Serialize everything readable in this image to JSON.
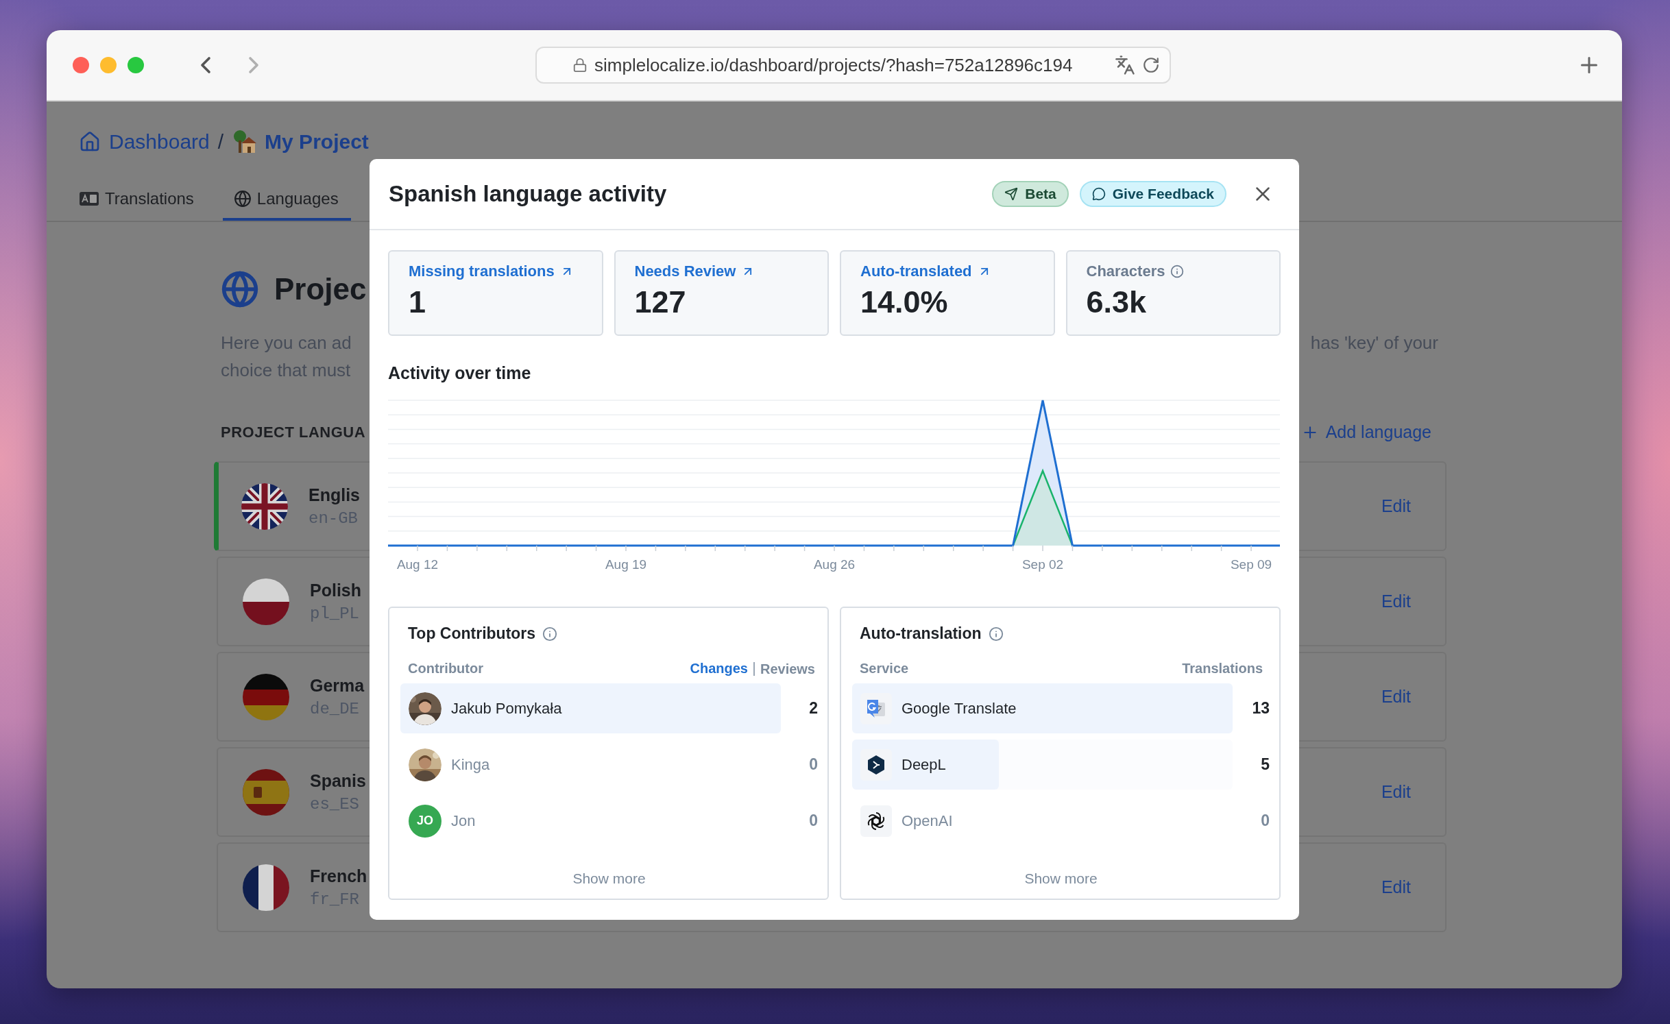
{
  "browser": {
    "url": "simplelocalize.io/dashboard/projects/?hash=752a12896c194"
  },
  "breadcrumb": {
    "root": "Dashboard",
    "separator": "/",
    "project": "My Project"
  },
  "tabs": [
    {
      "label": "Translations",
      "selected": false
    },
    {
      "label": "Languages",
      "selected": true
    }
  ],
  "page": {
    "title": "Projec",
    "description_left": [
      "Here you can ad",
      "choice that must"
    ],
    "description_right": "has 'key' of your",
    "section_heading": "PROJECT LANGUA",
    "add_button": "Add language"
  },
  "languages": [
    {
      "name": "Englis",
      "code": "en-GB",
      "default": true,
      "action": "Edit"
    },
    {
      "name": "Polish",
      "code": "pl_PL",
      "default": false,
      "action": "Edit"
    },
    {
      "name": "Germa",
      "code": "de_DE",
      "default": false,
      "action": "Edit"
    },
    {
      "name": "Spanis",
      "code": "es_ES",
      "default": false,
      "action": "Edit"
    },
    {
      "name": "French",
      "code": "fr_FR",
      "default": false,
      "action": "Edit"
    }
  ],
  "modal": {
    "title": "Spanish language activity",
    "badges": [
      {
        "label": "Beta",
        "kind": "beta"
      },
      {
        "label": "Give Feedback",
        "kind": "feedback"
      }
    ],
    "stats": [
      {
        "label": "Missing translations",
        "value": "1",
        "kind": "link"
      },
      {
        "label": "Needs Review",
        "value": "127",
        "kind": "link"
      },
      {
        "label": "Auto-translated",
        "value": "14.0%",
        "kind": "link"
      },
      {
        "label": "Characters",
        "value": "6.3k",
        "kind": "info"
      }
    ],
    "activity": {
      "title": "Activity over time",
      "x_labels": [
        "Aug 12",
        "Aug 19",
        "Aug 26",
        "Sep 02",
        "Sep 09"
      ]
    },
    "contributors": {
      "title": "Top Contributors",
      "column_1": "Contributor",
      "metrics": [
        {
          "label": "Changes",
          "selected": true
        },
        {
          "label": "Reviews",
          "selected": false
        }
      ],
      "rows": [
        {
          "name": "Jakub Pomykała",
          "value": "2",
          "level": 1,
          "muted": false
        },
        {
          "name": "Kinga",
          "value": "0",
          "muted": true
        },
        {
          "name": "Jon",
          "initials": "JO",
          "value": "0",
          "muted": true,
          "kind": "initials"
        }
      ],
      "more": "Show more"
    },
    "auto_translation": {
      "title": "Auto-translation",
      "column_1": "Service",
      "column_2": "Translations",
      "rows": [
        {
          "name": "Google Translate",
          "value": "13",
          "level": 1,
          "muted": false
        },
        {
          "name": "DeepL",
          "value": "5",
          "level": 0.385,
          "muted": false
        },
        {
          "name": "OpenAI",
          "value": "0",
          "muted": true
        }
      ],
      "more": "Show more"
    }
  }
}
